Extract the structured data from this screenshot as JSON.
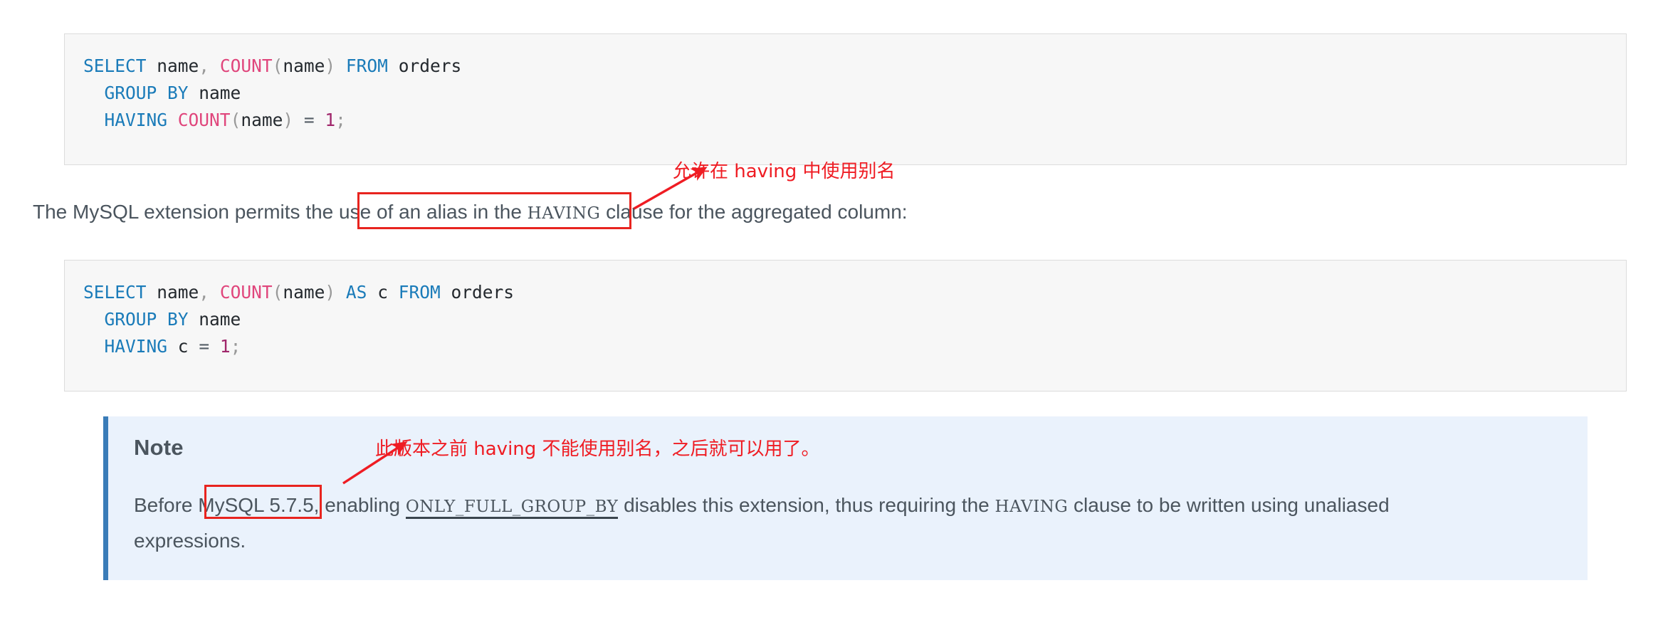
{
  "doc": {
    "code_block_1": {
      "lines": [
        [
          {
            "t": "SELECT",
            "c": "kw"
          },
          {
            "t": " ",
            "c": "plain"
          },
          {
            "t": "name",
            "c": "ident"
          },
          {
            "t": ",",
            "c": "punc"
          },
          {
            "t": " ",
            "c": "plain"
          },
          {
            "t": "COUNT",
            "c": "fn"
          },
          {
            "t": "(",
            "c": "punc"
          },
          {
            "t": "name",
            "c": "ident"
          },
          {
            "t": ")",
            "c": "punc"
          },
          {
            "t": " ",
            "c": "plain"
          },
          {
            "t": "FROM",
            "c": "kw"
          },
          {
            "t": " ",
            "c": "plain"
          },
          {
            "t": "orders",
            "c": "ident"
          }
        ],
        [
          {
            "t": "  ",
            "c": "plain"
          },
          {
            "t": "GROUP BY",
            "c": "kw"
          },
          {
            "t": " ",
            "c": "plain"
          },
          {
            "t": "name",
            "c": "ident"
          }
        ],
        [
          {
            "t": "  ",
            "c": "plain"
          },
          {
            "t": "HAVING",
            "c": "kw"
          },
          {
            "t": " ",
            "c": "plain"
          },
          {
            "t": "COUNT",
            "c": "fn"
          },
          {
            "t": "(",
            "c": "punc"
          },
          {
            "t": "name",
            "c": "ident"
          },
          {
            "t": ")",
            "c": "punc"
          },
          {
            "t": " ",
            "c": "plain"
          },
          {
            "t": "=",
            "c": "op"
          },
          {
            "t": " ",
            "c": "plain"
          },
          {
            "t": "1",
            "c": "num"
          },
          {
            "t": ";",
            "c": "punc"
          }
        ]
      ],
      "plain_text": "SELECT name, COUNT(name) FROM orders\n  GROUP BY name\n  HAVING COUNT(name) = 1;"
    },
    "paragraph": {
      "before": "The MySQL extension permits the ",
      "highlight_start": "use of an alias in the ",
      "highlight_code": "HAVING",
      "after": " clause for the aggregated column:",
      "full_text": "The MySQL extension permits the use of an alias in the HAVING clause for the aggregated column:"
    },
    "code_block_2": {
      "lines": [
        [
          {
            "t": "SELECT",
            "c": "kw"
          },
          {
            "t": " ",
            "c": "plain"
          },
          {
            "t": "name",
            "c": "ident"
          },
          {
            "t": ",",
            "c": "punc"
          },
          {
            "t": " ",
            "c": "plain"
          },
          {
            "t": "COUNT",
            "c": "fn"
          },
          {
            "t": "(",
            "c": "punc"
          },
          {
            "t": "name",
            "c": "ident"
          },
          {
            "t": ")",
            "c": "punc"
          },
          {
            "t": " ",
            "c": "plain"
          },
          {
            "t": "AS",
            "c": "kw"
          },
          {
            "t": " ",
            "c": "plain"
          },
          {
            "t": "c",
            "c": "ident"
          },
          {
            "t": " ",
            "c": "plain"
          },
          {
            "t": "FROM",
            "c": "kw"
          },
          {
            "t": " ",
            "c": "plain"
          },
          {
            "t": "orders",
            "c": "ident"
          }
        ],
        [
          {
            "t": "  ",
            "c": "plain"
          },
          {
            "t": "GROUP BY",
            "c": "kw"
          },
          {
            "t": " ",
            "c": "plain"
          },
          {
            "t": "name",
            "c": "ident"
          }
        ],
        [
          {
            "t": "  ",
            "c": "plain"
          },
          {
            "t": "HAVING",
            "c": "kw"
          },
          {
            "t": " ",
            "c": "plain"
          },
          {
            "t": "c",
            "c": "ident"
          },
          {
            "t": " ",
            "c": "plain"
          },
          {
            "t": "=",
            "c": "op"
          },
          {
            "t": " ",
            "c": "plain"
          },
          {
            "t": "1",
            "c": "num"
          },
          {
            "t": ";",
            "c": "punc"
          }
        ]
      ],
      "plain_text": "SELECT name, COUNT(name) AS c FROM orders\n  GROUP BY name\n  HAVING c = 1;"
    },
    "note": {
      "title": "Note",
      "line1_a": "Before ",
      "line1_highlight": "MySQL 5.7.5",
      "line1_b": ", enabling ",
      "line1_code": "ONLY_FULL_GROUP_BY",
      "line1_c": " disables this extension, thus requiring the ",
      "line1_code2": "HAVING",
      "line1_d": " clause to be written using unaliased",
      "line2": "expressions.",
      "full_text": "Before MySQL 5.7.5, enabling ONLY_FULL_GROUP_BY disables this extension, thus requiring the HAVING clause to be written using unaliased expressions."
    },
    "annotations": [
      {
        "id": "annotation-having-alias",
        "text": "允许在 having 中使用别名",
        "color": "#ef1c23"
      },
      {
        "id": "annotation-version-note",
        "text": "此版本之前 having 不能使用别名，之后就可以用了。",
        "color": "#ef1c23"
      }
    ],
    "colors": {
      "annotation_red": "#ef1c23",
      "highlight_box_red": "#e8241f",
      "code_bg": "#f7f7f7",
      "code_border": "#dcdcdc",
      "note_bg": "#eaf2fc",
      "note_accent": "#3a7cb8",
      "keyword_blue": "#1a7bb9",
      "function_pink": "#e0467c",
      "text_gray": "#4b555e"
    }
  }
}
